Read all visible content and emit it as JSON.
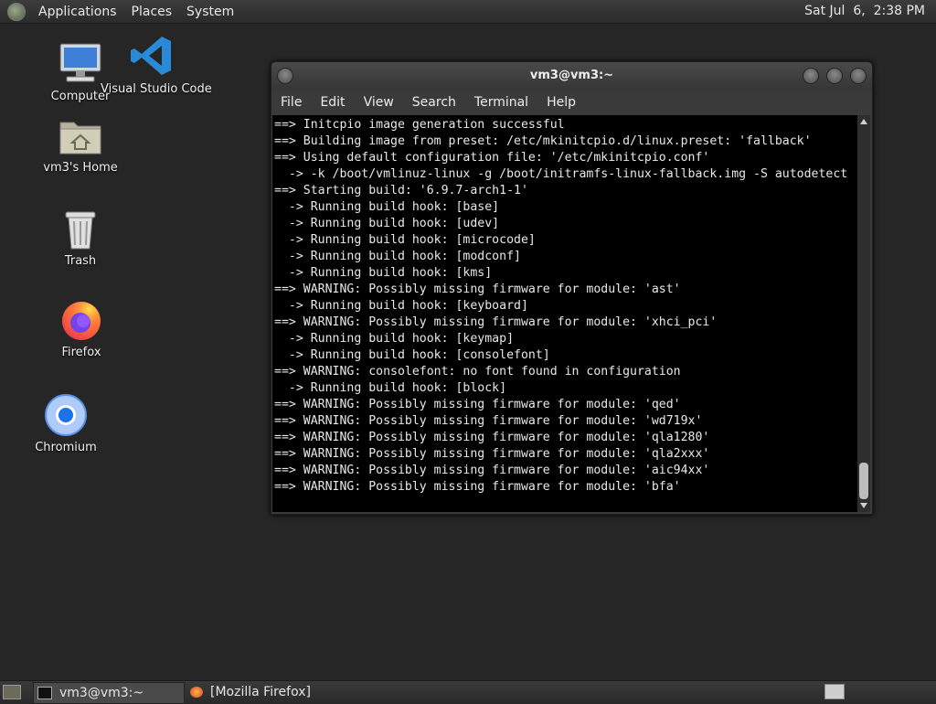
{
  "top_panel": {
    "menus": [
      "Applications",
      "Places",
      "System"
    ],
    "clock": "Sat Jul  6,  2:38 PM"
  },
  "desktop": {
    "icons": [
      {
        "label": "Computer",
        "icon": "computer-icon"
      },
      {
        "label": "Visual Studio Code",
        "icon": "vscode-icon"
      },
      {
        "label": "vm3's Home",
        "icon": "home-folder-icon"
      },
      {
        "label": "Trash",
        "icon": "trash-icon"
      },
      {
        "label": "Firefox",
        "icon": "firefox-icon"
      },
      {
        "label": "Chromium",
        "icon": "chromium-icon"
      }
    ]
  },
  "window": {
    "title": "vm3@vm3:~",
    "menu": [
      "File",
      "Edit",
      "View",
      "Search",
      "Terminal",
      "Help"
    ],
    "terminal_lines": [
      "==> Initcpio image generation successful",
      "==> Building image from preset: /etc/mkinitcpio.d/linux.preset: 'fallback'",
      "==> Using default configuration file: '/etc/mkinitcpio.conf'",
      "  -> -k /boot/vmlinuz-linux -g /boot/initramfs-linux-fallback.img -S autodetect",
      "==> Starting build: '6.9.7-arch1-1'",
      "  -> Running build hook: [base]",
      "  -> Running build hook: [udev]",
      "  -> Running build hook: [microcode]",
      "  -> Running build hook: [modconf]",
      "  -> Running build hook: [kms]",
      "==> WARNING: Possibly missing firmware for module: 'ast'",
      "  -> Running build hook: [keyboard]",
      "==> WARNING: Possibly missing firmware for module: 'xhci_pci'",
      "  -> Running build hook: [keymap]",
      "  -> Running build hook: [consolefont]",
      "==> WARNING: consolefont: no font found in configuration",
      "  -> Running build hook: [block]",
      "==> WARNING: Possibly missing firmware for module: 'qed'",
      "==> WARNING: Possibly missing firmware for module: 'wd719x'",
      "==> WARNING: Possibly missing firmware for module: 'qla1280'",
      "==> WARNING: Possibly missing firmware for module: 'qla2xxx'",
      "==> WARNING: Possibly missing firmware for module: 'aic94xx'",
      "==> WARNING: Possibly missing firmware for module: 'bfa'"
    ]
  },
  "taskbar": {
    "tasks": [
      "vm3@vm3:~",
      "[Mozilla Firefox]"
    ]
  }
}
